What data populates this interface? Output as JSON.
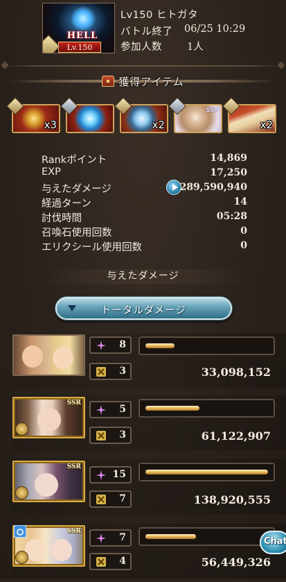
{
  "quest": {
    "difficulty_tag": "HELL",
    "level_tag": "Lv.150",
    "name": "Lv150 ヒトガタ",
    "battle_end_label": "バトル終了",
    "battle_end_value": "06/25 10:29",
    "participants_label": "参加人数",
    "participants_value": "1人"
  },
  "items": {
    "title": "獲得アイテム",
    "list": [
      {
        "icon": "gold-medal-icon",
        "qty": "x3"
      },
      {
        "icon": "blue-orb-icon",
        "qty": ""
      },
      {
        "icon": "silver-crest-icon",
        "qty": "x2"
      },
      {
        "icon": "ssr-character-icon",
        "qty": "",
        "badge": "SSR"
      },
      {
        "icon": "scroll-icon",
        "qty": "x2"
      }
    ]
  },
  "stats": [
    {
      "label": "Rankポイント",
      "value": "14,869"
    },
    {
      "label": "EXP",
      "value": "17,250"
    },
    {
      "label": "与えたダメージ",
      "value": "289,590,940"
    },
    {
      "label": "経過ターン",
      "value": "14"
    },
    {
      "label": "討伐時間",
      "value": "05:28"
    },
    {
      "label": "召喚石使用回数",
      "value": "0"
    },
    {
      "label": "エリクシール使用回数",
      "value": "0"
    }
  ],
  "damage": {
    "title": "与えたダメージ",
    "total_button": "トータルダメージ",
    "rows": [
      {
        "count_a": "8",
        "count_b": "3",
        "value": "33,098,152",
        "bar_fraction": 0.24,
        "ssr": ""
      },
      {
        "count_a": "5",
        "count_b": "3",
        "value": "61,122,907",
        "bar_fraction": 0.44,
        "ssr": "SSR"
      },
      {
        "count_a": "15",
        "count_b": "7",
        "value": "138,920,555",
        "bar_fraction": 1.0,
        "ssr": "SSR"
      },
      {
        "count_a": "7",
        "count_b": "4",
        "value": "56,449,326",
        "bar_fraction": 0.41,
        "ssr": "SSR"
      }
    ]
  },
  "chat": {
    "label": "Chat"
  },
  "colors": {
    "background": "#2b231d",
    "bar_fill": "#e3b254",
    "accent_blue": "#2e6f88"
  }
}
